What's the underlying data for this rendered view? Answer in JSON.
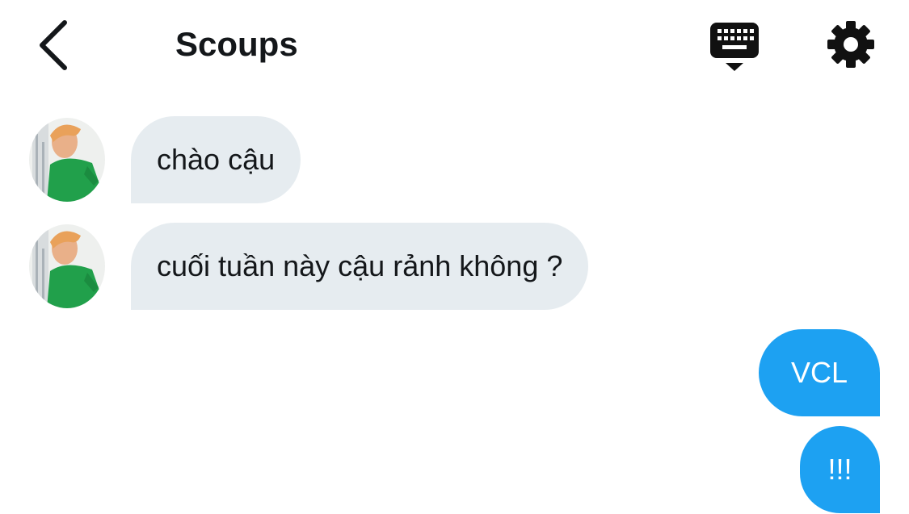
{
  "header": {
    "title": "Scoups",
    "back_icon": "chevron-left-icon",
    "keyboard_icon": "keyboard-hide-icon",
    "settings_icon": "gear-icon"
  },
  "messages": [
    {
      "direction": "incoming",
      "text": "chào cậu"
    },
    {
      "direction": "incoming",
      "text": "cuối tuần này cậu rảnh không ?"
    },
    {
      "direction": "outgoing",
      "text": "VCL"
    },
    {
      "direction": "outgoing",
      "text": "!!!"
    }
  ],
  "colors": {
    "incoming_bubble": "#e6ecf0",
    "outgoing_bubble": "#1da1f2",
    "text": "#14171a"
  }
}
